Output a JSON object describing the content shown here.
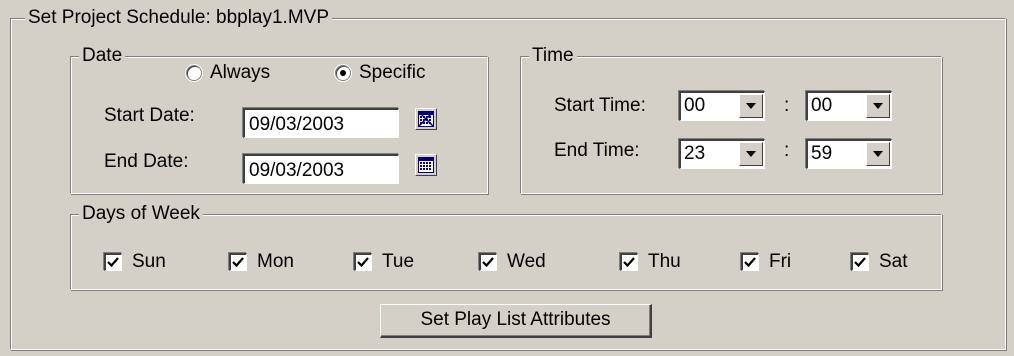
{
  "main_group": {
    "title": "Set Project Schedule: bbplay1.MVP"
  },
  "date_group": {
    "title": "Date",
    "radio_always": {
      "label": "Always",
      "checked": false
    },
    "radio_specific": {
      "label": "Specific",
      "checked": true
    },
    "start_date": {
      "label": "Start Date:",
      "value": "09/03/2003",
      "icon": "calendar-icon"
    },
    "end_date": {
      "label": "End Date:",
      "value": "09/03/2003",
      "icon": "calendar-icon"
    }
  },
  "time_group": {
    "title": "Time",
    "start_time": {
      "label": "Start Time:",
      "hour": "00",
      "separator": ":",
      "minute": "00"
    },
    "end_time": {
      "label": "End Time:",
      "hour": "23",
      "separator": ":",
      "minute": "59"
    }
  },
  "days_group": {
    "title": "Days of Week",
    "days": [
      {
        "label": "Sun",
        "checked": true
      },
      {
        "label": "Mon",
        "checked": true
      },
      {
        "label": "Tue",
        "checked": true
      },
      {
        "label": "Wed",
        "checked": true
      },
      {
        "label": "Thu",
        "checked": true
      },
      {
        "label": "Fri",
        "checked": true
      },
      {
        "label": "Sat",
        "checked": true
      }
    ]
  },
  "actions": {
    "set_play_list_label": "Set Play List Attributes"
  },
  "colors": {
    "face": "#d4d0c8",
    "calendar_accent": "#000080"
  }
}
